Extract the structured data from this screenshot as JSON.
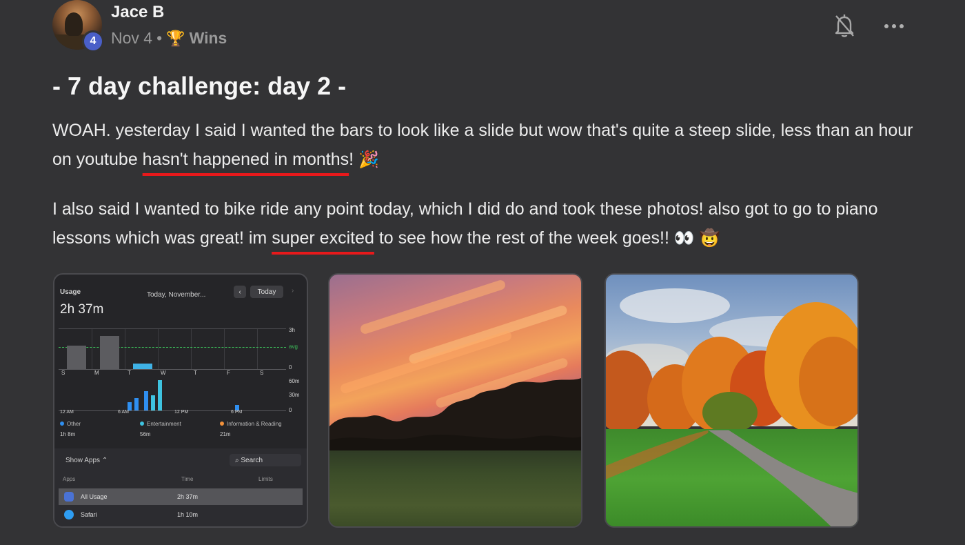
{
  "post": {
    "author": "Jace B",
    "level": "4",
    "date": "Nov 4",
    "separator": "•",
    "category_icon": "🏆",
    "category": "Wins",
    "title": "- 7 day challenge: day 2 -",
    "p1_a": "WOAH. yesterday I said I wanted the bars to look like a slide but wow that's quite a steep slide, less than an hour on youtube ",
    "p1_ul": "hasn't happened in months",
    "p1_b": "! ",
    "p1_emoji": "🎉",
    "p2_a": "I also said I wanted to bike ride any point today, which I did do and took these photos! also got to go to piano lessons which was great! im ",
    "p2_ul": "super excited",
    "p2_b": " to see how the rest of the week goes!! ",
    "p2_emoji1": "👀",
    "p2_emoji2": "🤠"
  },
  "screenshot": {
    "usage_label": "Usage",
    "total": "2h 37m",
    "date_select": "Today, November...",
    "today_button": "Today",
    "weekday_labels": [
      "S",
      "M",
      "T",
      "W",
      "T",
      "F",
      "S"
    ],
    "axis_right": [
      "3h",
      "avg",
      "0"
    ],
    "axis_right2": [
      "60m",
      "30m",
      "0"
    ],
    "hour_labels": [
      "12 AM",
      "6 AM",
      "12 PM",
      "6 PM"
    ],
    "legend": [
      {
        "name": "Other",
        "value": "1h 8m",
        "color": "#2f8ff0"
      },
      {
        "name": "Entertainment",
        "value": "56m",
        "color": "#3ec3e0"
      },
      {
        "name": "Information & Reading",
        "value": "21m",
        "color": "#f2913a"
      }
    ],
    "show_apps": "Show Apps",
    "search_placeholder": "Search",
    "columns": [
      "Apps",
      "Time",
      "Limits"
    ],
    "rows": [
      {
        "name": "All Usage",
        "time": "2h 37m"
      },
      {
        "name": "Safari",
        "time": "1h 10m"
      }
    ]
  }
}
